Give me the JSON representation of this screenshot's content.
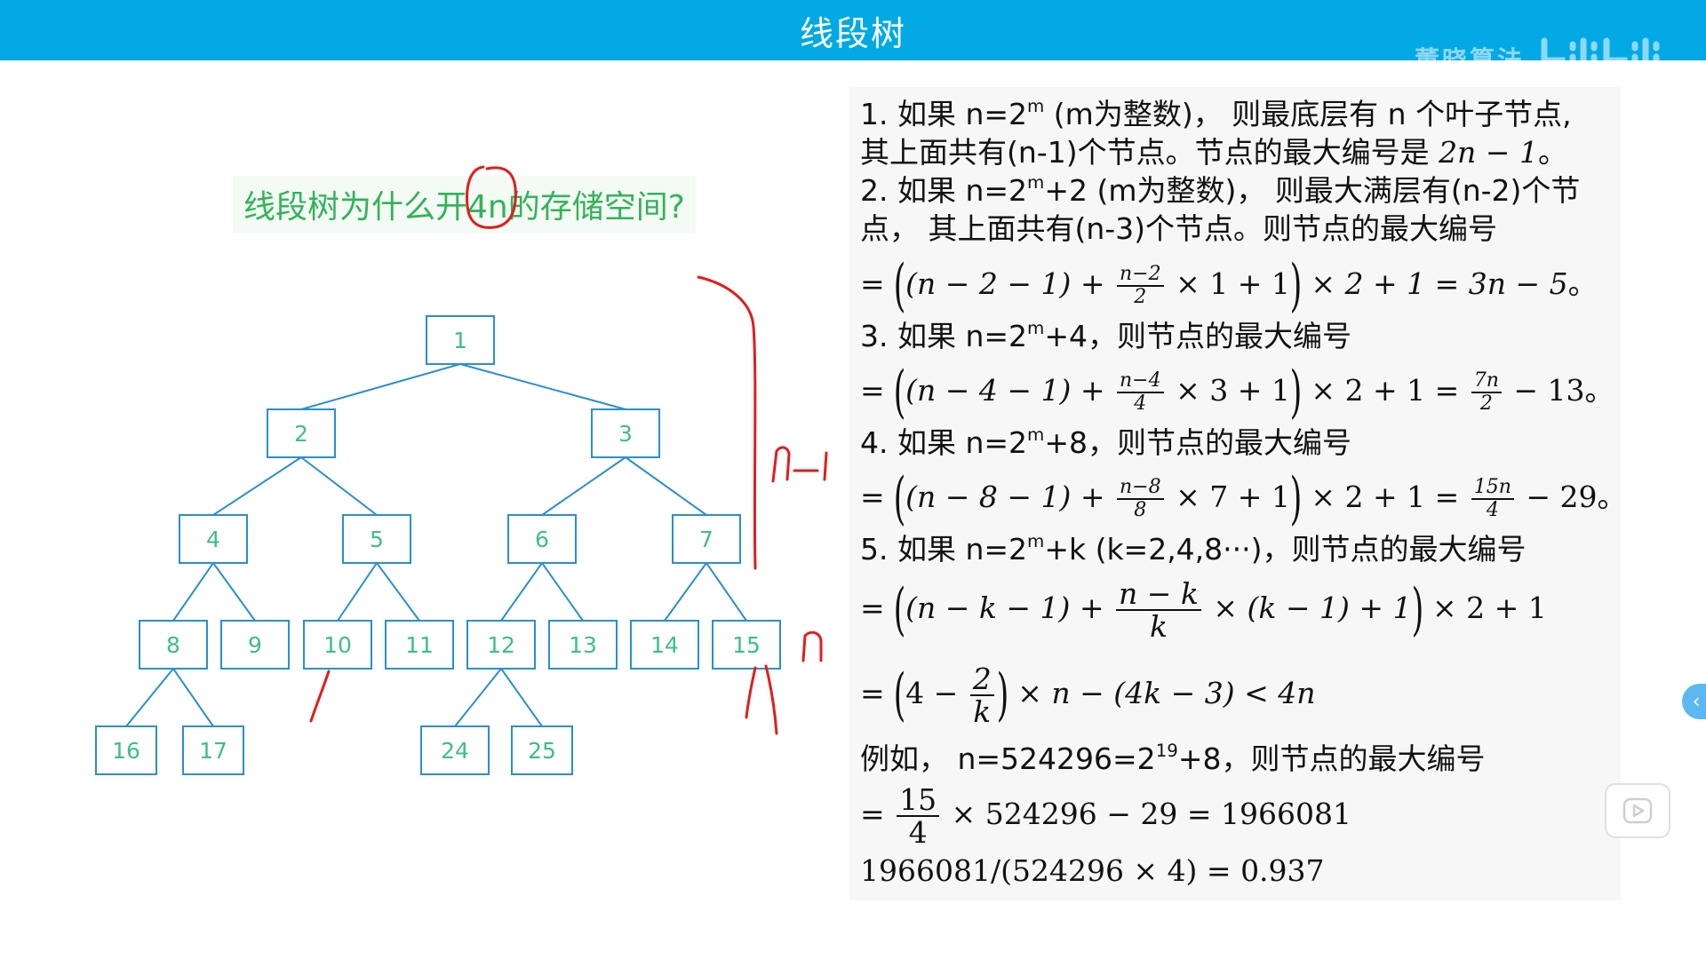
{
  "header": {
    "title": "线段树",
    "watermark_text": "董晓算法",
    "watermark_logo": "bilibili",
    "watermark_logo_icon": "bilibili-logo-icon",
    "bar_color": "#03a9e4"
  },
  "question": {
    "text": "线段树为什么开4n的存储空间?",
    "highlight_color": "#33b35a",
    "annotation_color": "#e11d1d"
  },
  "tree": {
    "node_labels": [
      "1",
      "2",
      "3",
      "4",
      "5",
      "6",
      "7",
      "8",
      "9",
      "10",
      "11",
      "12",
      "13",
      "14",
      "15",
      "16",
      "17",
      "24",
      "25"
    ],
    "node_stroke_color": "#2a8fcf",
    "annotations": {
      "depth_label": "n-1",
      "leaf_label": "n"
    }
  },
  "math": {
    "l1a": "1.  如果 n=2",
    "l1a_sup": "m",
    "l1b": " (m为整数)， 则最底层有 n 个叶子节点,",
    "l2a": "其上面共有(n-1)个节点。节点的最大编号是 ",
    "l2b": "2n − 1",
    "l2c": "。",
    "l3a": "2.  如果 n=2",
    "l3a_sup": "m",
    "l3b": "+2 (m为整数)， 则最大满层有(n-2)个节",
    "l4": "点， 其上面共有(n-3)个节点。则节点的最大编号",
    "l5_pre": "= ",
    "l5_in": "(n − 2 − 1) + ",
    "l5_num": "n−2",
    "l5_den": "2",
    "l5_mid": " × 1 + 1",
    "l5_post": " × 2 + 1 = 3n − 5",
    "l5_end": "。",
    "l6a": "3.  如果 n=2",
    "l6a_sup": "m",
    "l6b": "+4，则节点的最大编号",
    "l7_pre": "= ",
    "l7_in": "(n − 4 − 1) + ",
    "l7_num": "n−4",
    "l7_den": "4",
    "l7_mid": " × 3 + 1",
    "l7_post": " × 2 + 1 = ",
    "l7_num2": "7n",
    "l7_den2": "2",
    "l7_tail": " − 13",
    "l7_end": "。",
    "l8a": "4.  如果 n=2",
    "l8a_sup": "m",
    "l8b": "+8，则节点的最大编号",
    "l9_pre": "= ",
    "l9_in": "(n − 8 − 1) + ",
    "l9_num": "n−8",
    "l9_den": "8",
    "l9_mid": " × 7 + 1",
    "l9_post": " × 2 + 1 = ",
    "l9_num2": "15n",
    "l9_den2": "4",
    "l9_tail": " − 29",
    "l9_end": "。",
    "l10a": "5.  如果 n=2",
    "l10a_sup": "m",
    "l10b": "+k (k=2,4,8···)，则节点的最大编号",
    "l11_pre": "= ",
    "l11_in": "(n − k − 1) + ",
    "l11_num": "n − k",
    "l11_den": "k",
    "l11_mid": " × (k − 1) + 1",
    "l11_post": " × 2 + 1",
    "l12_pre": "= ",
    "l12_in": "4 − ",
    "l12_num": "2",
    "l12_den": "k",
    "l12_post": " × n − (4k − 3) < 4n",
    "l13a": "例如， n=524296=2",
    "l13a_sup": "19",
    "l13b": "+8，则节点的最大编号",
    "l14_pre": "= ",
    "l14_num": "15",
    "l14_den": "4",
    "l14_post": " × 524296 − 29 = 1966081",
    "l15": "1966081/(524296 × 4) = 0.937"
  },
  "controls": {
    "collapse_arrow": "‹",
    "play_icon": "play-icon"
  }
}
